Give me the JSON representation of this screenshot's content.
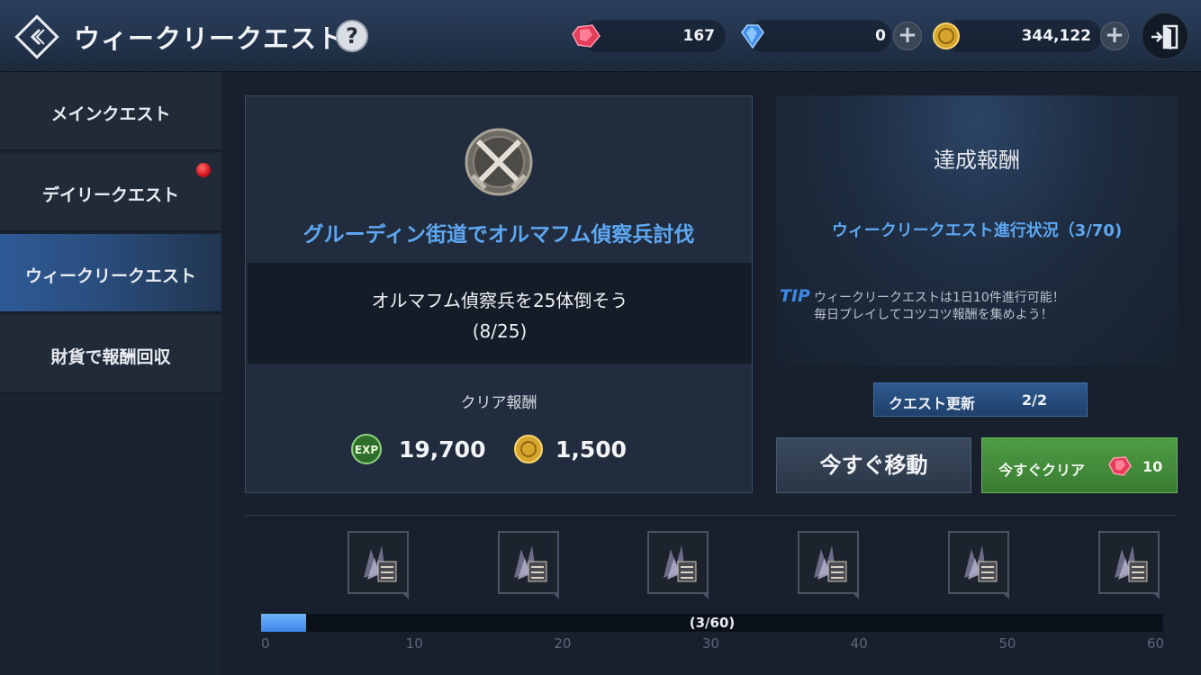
{
  "header": {
    "title": "ウィークリークエスト",
    "help_label": "?",
    "currencies": [
      {
        "name": "ruby",
        "value": "167"
      },
      {
        "name": "diamond",
        "value": "0"
      },
      {
        "name": "gold",
        "value": "344,122"
      }
    ],
    "plus_label": "+"
  },
  "sidebar": {
    "items": [
      {
        "label": "メインクエスト"
      },
      {
        "label": "デイリークエスト"
      },
      {
        "label": "ウィークリークエスト"
      },
      {
        "label": "財貨で報酬回収"
      }
    ],
    "active_index": 2
  },
  "quest": {
    "name": "グルーディン街道でオルマフム偵察兵討伐",
    "objective": "オルマフム偵察兵を25体倒そう",
    "progress": "(8/25)",
    "clear_reward_label": "クリア報酬",
    "exp_reward": "19,700",
    "gold_reward": "1,500"
  },
  "rewards_panel": {
    "title": "達成報酬",
    "progress_text": "ウィークリークエスト進行状況（3/70)",
    "tip_label": "TIP",
    "tip_line1": "ウィークリークエストは1日10件進行可能！",
    "tip_line2": "毎日プレイしてコツコツ報酬を集めよう！",
    "refresh_label": "クエスト更新",
    "refresh_count": "2/2",
    "move_now_label": "今すぐ移動",
    "clear_now_label": "今すぐクリア",
    "clear_now_cost": "10"
  },
  "track": {
    "label": "(3/60)",
    "current": 3,
    "max": 60,
    "ticks": [
      "0",
      "10",
      "20",
      "30",
      "40",
      "50",
      "60"
    ],
    "reward_count": 6
  },
  "colors": {
    "accent_blue": "#5ea7f2",
    "green_button": "#4e9c45",
    "notification": "#d4121b"
  },
  "icons": [
    "back-icon",
    "help-icon",
    "ruby-icon",
    "diamond-icon",
    "gold-coin-icon",
    "exit-icon",
    "crossed-swords-emblem-icon",
    "exp-icon",
    "reward-chest-icon"
  ]
}
